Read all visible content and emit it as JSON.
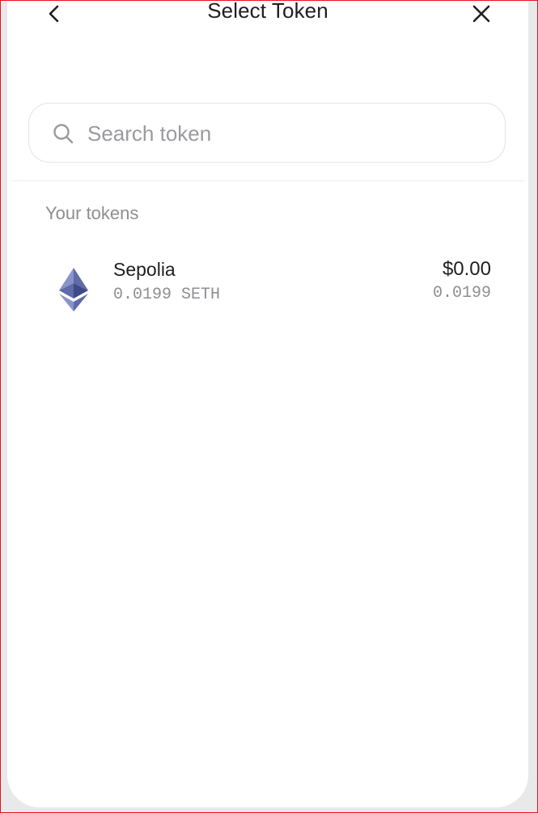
{
  "header": {
    "title": "Select Token",
    "back_icon": "chevron-left-icon",
    "close_icon": "close-icon"
  },
  "search": {
    "placeholder": "Search token",
    "value": "",
    "icon": "search-icon"
  },
  "section": {
    "label": "Your tokens"
  },
  "tokens": [
    {
      "name": "Sepolia",
      "balance_label": "0.0199 SETH",
      "usd_value": "$0.00",
      "amount": "0.0199",
      "icon": "ethereum-icon"
    }
  ],
  "colors": {
    "frame_border": "#e8121b",
    "text_primary": "#1f1f23",
    "text_secondary": "#8e8e93",
    "eth_icon": "#5f6aa8"
  }
}
